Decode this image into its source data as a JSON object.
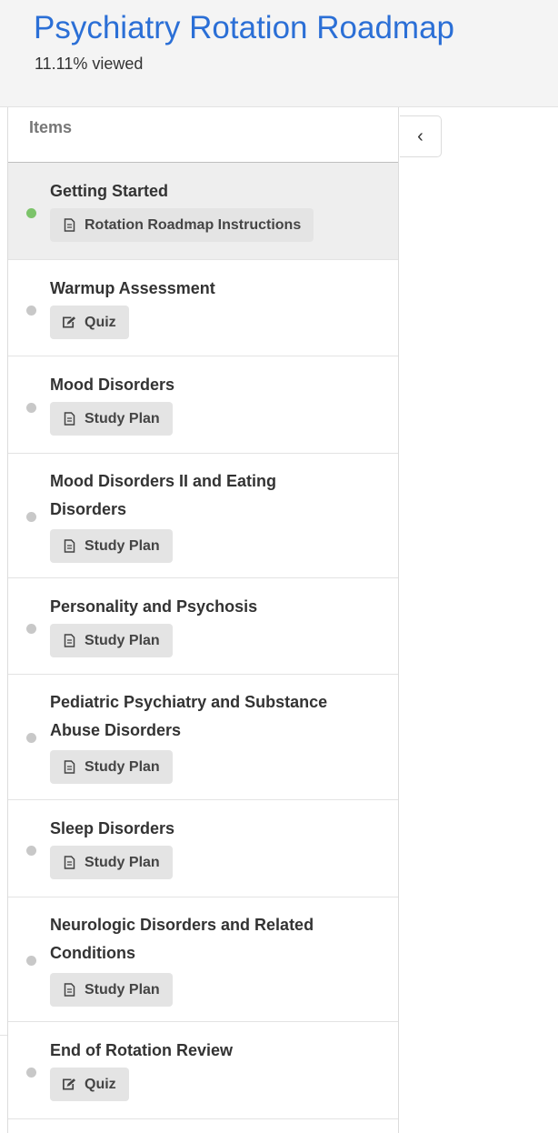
{
  "header": {
    "title": "Psychiatry Rotation Roadmap",
    "progress_text": "11.11% viewed"
  },
  "sidebar": {
    "heading": "Items",
    "collapse_glyph": "‹",
    "items": [
      {
        "title": "Getting Started",
        "status": "viewed",
        "chip": {
          "label": "Rotation Roadmap Instructions",
          "icon": "document-icon"
        }
      },
      {
        "title": "Warmup Assessment",
        "status": "not-viewed",
        "chip": {
          "label": "Quiz",
          "icon": "edit-icon"
        }
      },
      {
        "title": "Mood Disorders",
        "status": "not-viewed",
        "chip": {
          "label": "Study Plan",
          "icon": "document-icon"
        }
      },
      {
        "title": "Mood Disorders II and Eating Disorders",
        "status": "not-viewed",
        "chip": {
          "label": "Study Plan",
          "icon": "document-icon"
        }
      },
      {
        "title": "Personality and Psychosis",
        "status": "not-viewed",
        "chip": {
          "label": "Study Plan",
          "icon": "document-icon"
        }
      },
      {
        "title": "Pediatric Psychiatry and Substance Abuse Disorders",
        "status": "not-viewed",
        "chip": {
          "label": "Study Plan",
          "icon": "document-icon"
        }
      },
      {
        "title": "Sleep Disorders",
        "status": "not-viewed",
        "chip": {
          "label": "Study Plan",
          "icon": "document-icon"
        }
      },
      {
        "title": "Neurologic Disorders and Related Conditions",
        "status": "not-viewed",
        "chip": {
          "label": "Study Plan",
          "icon": "document-icon"
        }
      },
      {
        "title": "End of Rotation Review",
        "status": "not-viewed",
        "chip": {
          "label": "Quiz",
          "icon": "edit-icon"
        }
      }
    ]
  },
  "colors": {
    "title": "#2b6fd6",
    "viewed_dot": "#7cc36a",
    "unviewed_dot": "#c8c8c8",
    "chip_bg": "#e4e4e4"
  }
}
